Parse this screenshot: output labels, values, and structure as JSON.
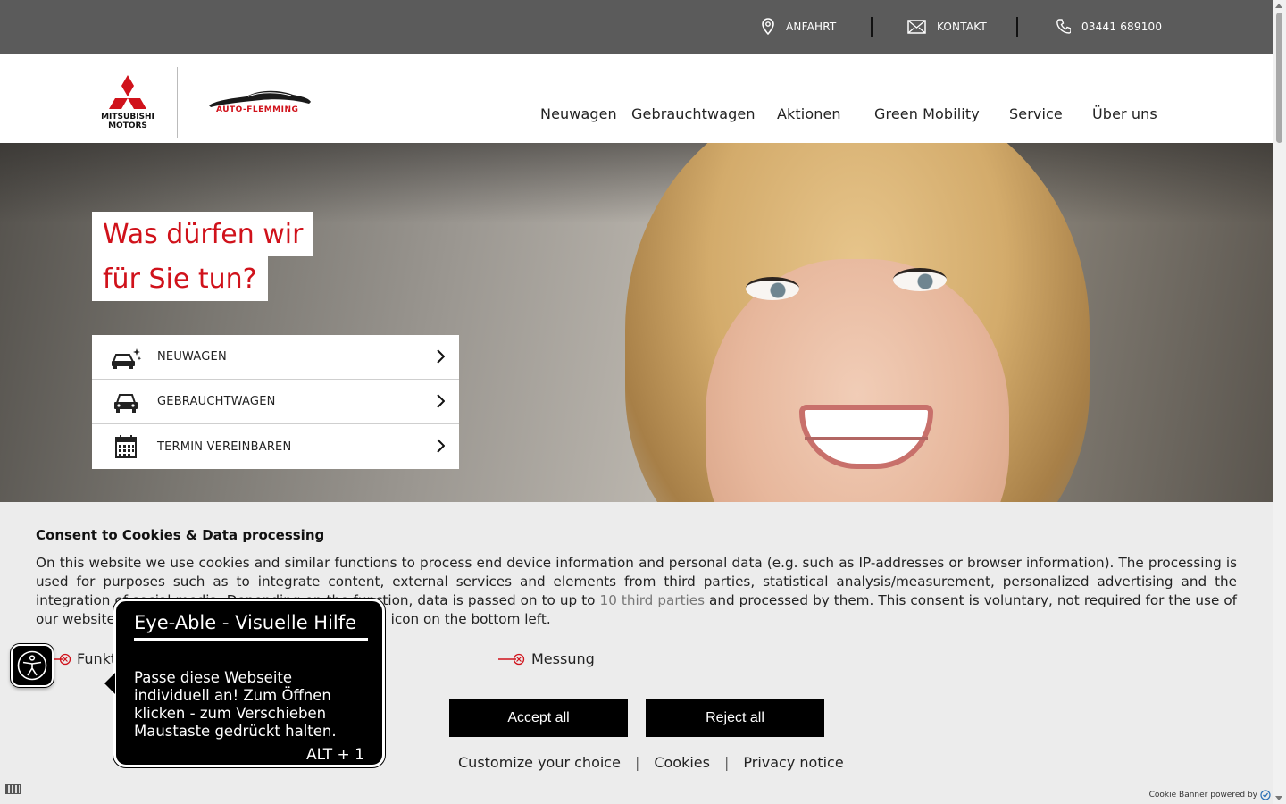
{
  "topbar": {
    "anfahrt": "ANFAHRT",
    "kontakt": "KONTAKT",
    "phone": "03441 689100"
  },
  "header": {
    "brand_mitsubishi_line1": "MITSUBISHI",
    "brand_mitsubishi_line2": "MOTORS",
    "brand_dealer": "AUTO-FLEMMING",
    "nav": [
      "Neuwagen",
      "Gebrauchtwagen",
      "Aktionen",
      "Green Mobility",
      "Service",
      "Über uns"
    ]
  },
  "hero": {
    "headline_line1": "Was dürfen wir",
    "headline_line2": "für Sie tun?",
    "quick_links": [
      {
        "label": "NEUWAGEN",
        "icon": "new-car-icon"
      },
      {
        "label": "GEBRAUCHTWAGEN",
        "icon": "car-icon"
      },
      {
        "label": "TERMIN VEREINBAREN",
        "icon": "calendar-icon"
      }
    ]
  },
  "cookie": {
    "title": "Consent to Cookies & Data processing",
    "text_before_link": "On this website we use cookies and similar functions to process end device information and personal data (e.g. such as IP-addresses or browser information). The processing is used for purposes such as to integrate content, external services and elements from third parties, statistical analysis/measurement, personalized advertising and the integration of social media. Depending on the function, data is passed on to up to ",
    "link_text": "10 third parties",
    "text_after_link": " and processed by them. This consent is voluntary, not required for the use of our website and can be revoked at any time via the icon on the bottom left.",
    "option_functional": "Funktional",
    "option_measurement": "Messung",
    "accept_all": "Accept all",
    "reject_all": "Reject all",
    "customize": "Customize your choice",
    "cookies": "Cookies",
    "privacy": "Privacy notice",
    "powered_by": "Cookie Banner powered by"
  },
  "eyeable": {
    "title": "Eye-Able - Visuelle Hilfe",
    "body": "Passe diese Webseite individuell an! Zum Öffnen klicken - zum Verschieben Maustaste gedrückt halten.",
    "shortcut": "ALT + 1"
  },
  "colors": {
    "accent_red": "#d0121b",
    "topbar": "#5b5b5b",
    "button": "#000000",
    "cookie_bg": "#ececec"
  }
}
